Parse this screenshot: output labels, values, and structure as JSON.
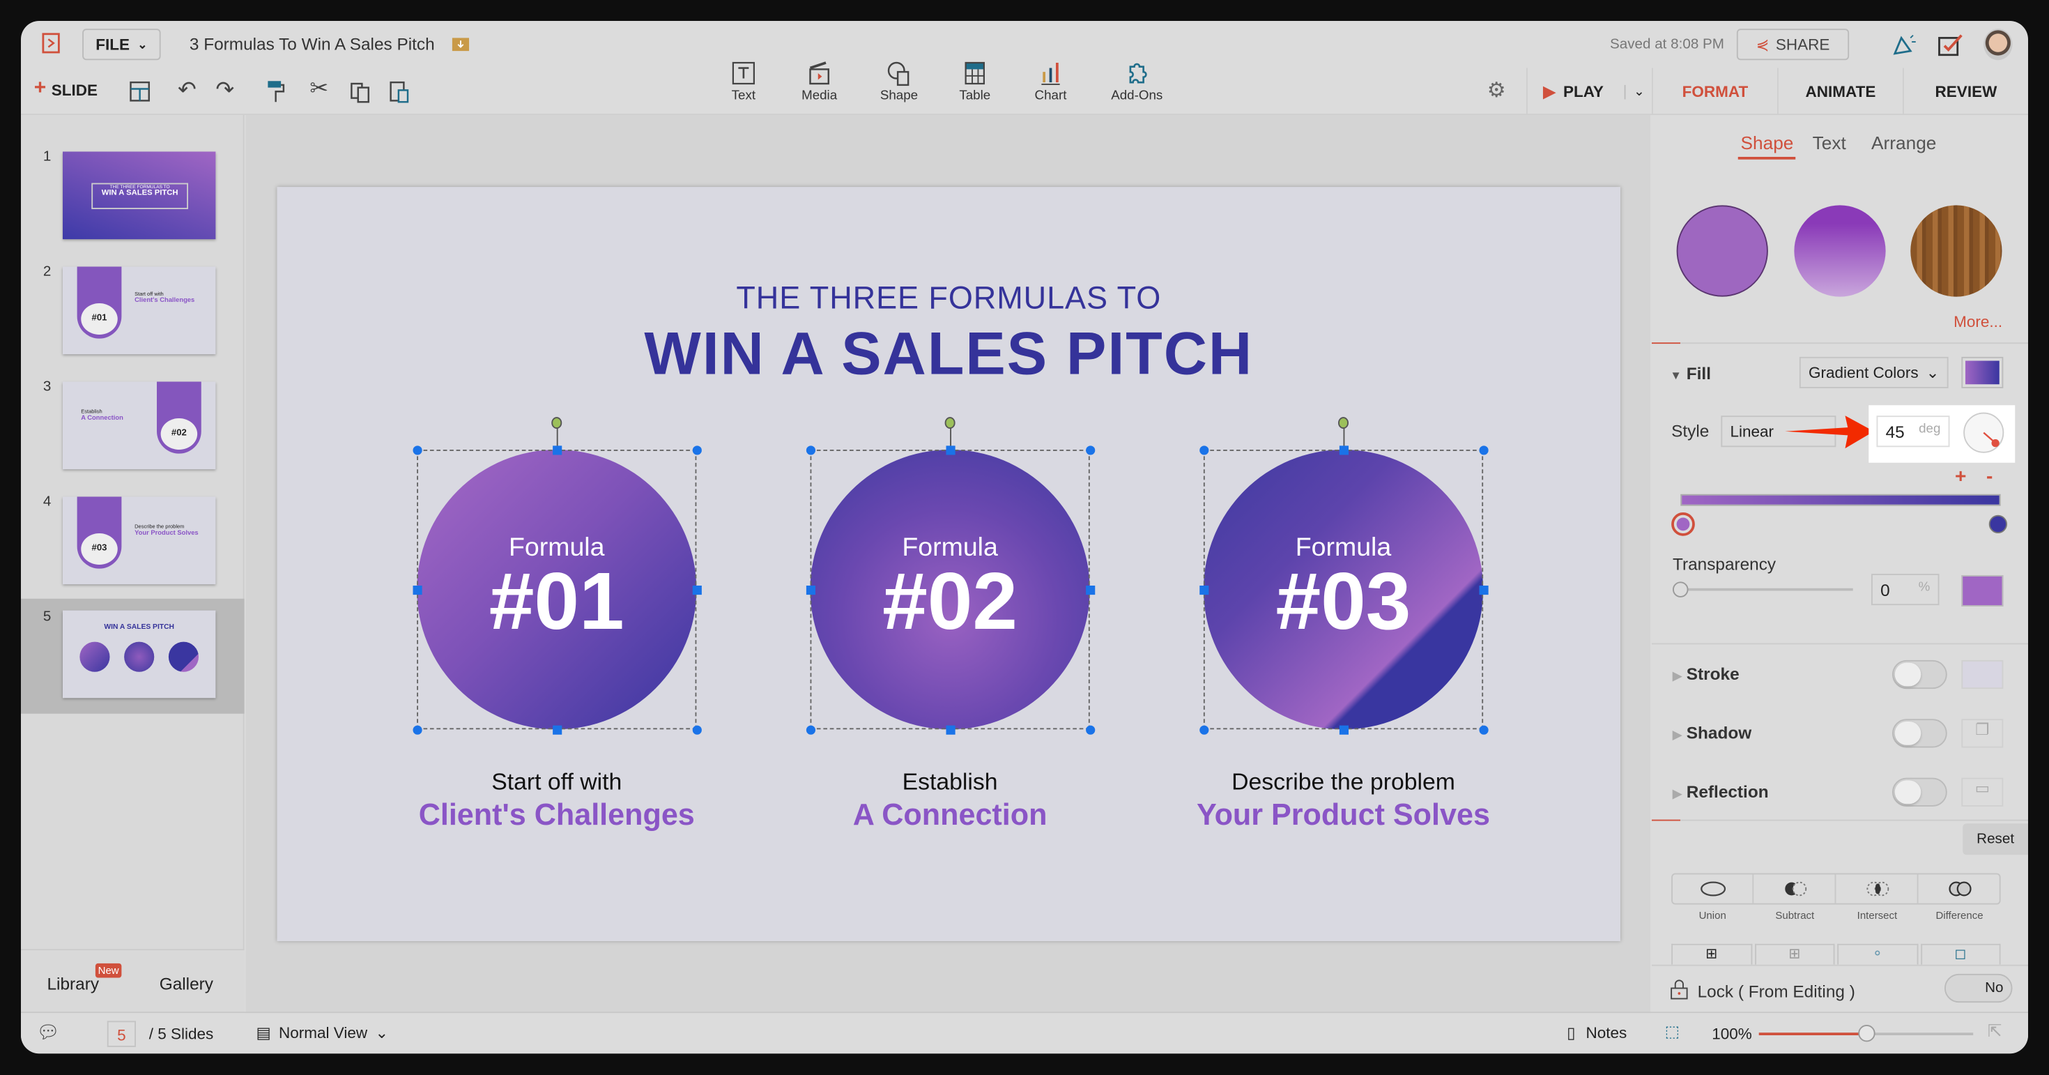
{
  "app": {
    "file_menu": "FILE",
    "doc_title": "3 Formulas To Win A Sales Pitch",
    "saved": "Saved at 8:08 PM",
    "share": "SHARE"
  },
  "toolbar": {
    "new_slide": "SLIDE",
    "insert": [
      {
        "label": "Text",
        "icon": "text-box-icon"
      },
      {
        "label": "Media",
        "icon": "media-clapper-icon"
      },
      {
        "label": "Shape",
        "icon": "shape-icon"
      },
      {
        "label": "Table",
        "icon": "table-icon"
      },
      {
        "label": "Chart",
        "icon": "chart-icon"
      },
      {
        "label": "Add-Ons",
        "icon": "puzzle-icon"
      }
    ],
    "play": "PLAY"
  },
  "panel_tabs": [
    "FORMAT",
    "ANIMATE",
    "REVIEW"
  ],
  "sub_tabs": [
    "Shape",
    "Text",
    "Arrange"
  ],
  "format": {
    "more": "More...",
    "fill_label": "Fill",
    "fill_type": "Gradient Colors",
    "style_label": "Style",
    "style_value": "Linear",
    "angle": "45",
    "angle_unit": "deg",
    "transparency_label": "Transparency",
    "transparency": "0",
    "transparency_unit": "%",
    "gradient_start": "#a066c4",
    "gradient_end": "#3a36a0",
    "stroke": "Stroke",
    "shadow": "Shadow",
    "reflection": "Reflection",
    "reset": "Reset",
    "bool_ops": [
      "Union",
      "Subtract",
      "Intersect",
      "Difference"
    ],
    "lock": "Lock ( From Editing )",
    "lock_value": "No"
  },
  "slides": [
    {
      "num": "1",
      "title_small": "THE THREE FORMULAS TO",
      "title": "WIN A SALES PITCH"
    },
    {
      "num": "2",
      "badge": "#01",
      "line1": "Start off with",
      "line2": "Client's Challenges"
    },
    {
      "num": "3",
      "badge": "#02",
      "line1": "Establish",
      "line2": "A Connection"
    },
    {
      "num": "4",
      "badge": "#03",
      "line1": "Describe the problem",
      "line2": "Your Product Solves"
    },
    {
      "num": "5",
      "title": "WIN A SALES PITCH"
    }
  ],
  "left_footer": {
    "library": "Library",
    "new_badge": "New",
    "gallery": "Gallery"
  },
  "slide": {
    "subtitle": "THE THREE FORMULAS TO",
    "title": "WIN A SALES PITCH",
    "formulas": [
      {
        "label": "Formula",
        "number": "#01",
        "line1": "Start off with",
        "line2": "Client's Challenges"
      },
      {
        "label": "Formula",
        "number": "#02",
        "line1": "Establish",
        "line2": "A Connection"
      },
      {
        "label": "Formula",
        "number": "#03",
        "line1": "Describe the problem",
        "line2": "Your Product Solves"
      }
    ]
  },
  "status": {
    "current_slide": "5",
    "total": "/ 5 Slides",
    "view": "Normal View",
    "notes": "Notes",
    "zoom": "100%",
    "zoom_level": 0.5
  }
}
